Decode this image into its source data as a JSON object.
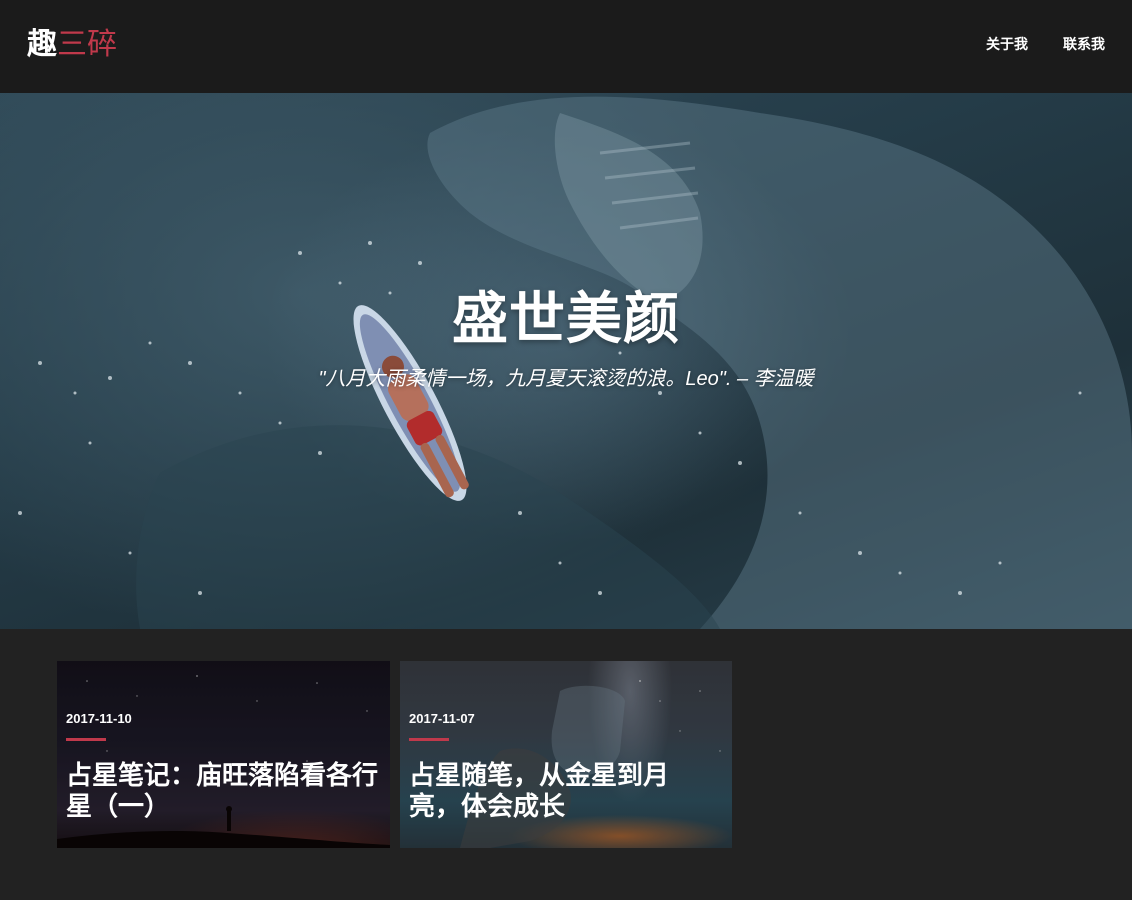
{
  "nav": {
    "brand_strong": "趣",
    "brand_accent": "三碎",
    "links": [
      {
        "label": "关于我"
      },
      {
        "label": "联系我"
      }
    ]
  },
  "hero": {
    "title": "盛世美颜",
    "quote": "\"八月大雨柔情一场，九月夏天滚烫的浪。Leo\". – 李温暖"
  },
  "posts": [
    {
      "date": "2017-11-10",
      "title": "占星笔记：庙旺落陷看各行星（一）"
    },
    {
      "date": "2017-11-07",
      "title": "占星随笔，从金星到月亮，体会成长"
    }
  ],
  "colors": {
    "accent": "#c0394b",
    "nav_bg": "#1b1b1b",
    "page_bg": "#222222"
  }
}
